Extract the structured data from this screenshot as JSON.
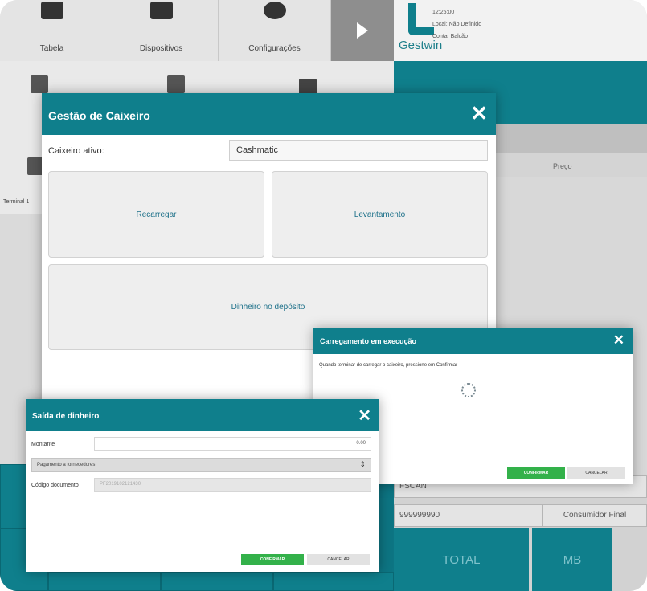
{
  "menu": {
    "items": [
      {
        "label": "Tabela",
        "icon": "table-icon"
      },
      {
        "label": "Dispositivos",
        "icon": "devices-icon"
      },
      {
        "label": "Configurações",
        "icon": "gear-icon"
      }
    ],
    "next_icon": "play-icon"
  },
  "brand": {
    "name": "Gestwin",
    "time": "12:25:00",
    "location": "Local: Não Definido",
    "account": "Conta: Balcão"
  },
  "terminal": {
    "label": "Terminal 1"
  },
  "list_header": {
    "price": "Preço"
  },
  "bottom": {
    "fiscal": "FSCAN",
    "nif": "999999990",
    "customer": "Consumidor Final",
    "total_label": "TOTAL",
    "payment": "MB"
  },
  "cashier_dialog": {
    "title": "Gestão de Caixeiro",
    "active_label": "Caixeiro ativo:",
    "active_value": "Cashmatic",
    "recharge_label": "Recarregar",
    "withdraw_label": "Levantamento",
    "deposit_label": "Dinheiro no depósito"
  },
  "charging_dialog": {
    "title": "Carregamento em execução",
    "message": "Quando terminar de carregar o caixeiro, pressione em Confirmar",
    "confirm_label": "CONFIRMAR",
    "cancel_label": "CANCELAR"
  },
  "cash_out_dialog": {
    "title": "Saída de dinheiro",
    "amount_label": "Montante",
    "amount_value": "0.00",
    "reason_selected": "Pagamento a fornecedores",
    "doc_code_label": "Código documento",
    "doc_code_placeholder": "PF2019102121430",
    "confirm_label": "CONFIRMAR",
    "cancel_label": "CANCELAR"
  },
  "colors": {
    "teal": "#0f7f8c",
    "confirm_green": "#33b14a"
  }
}
